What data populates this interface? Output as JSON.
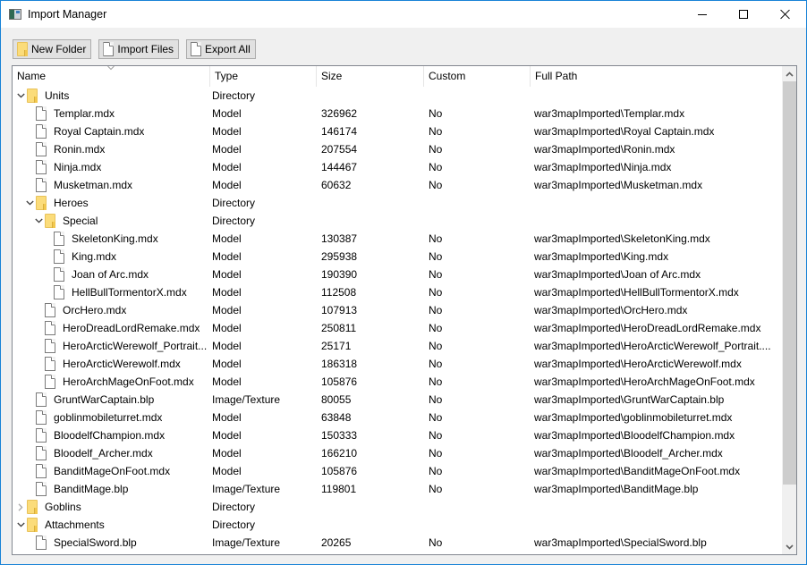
{
  "window": {
    "title": "Import Manager",
    "controls": {
      "minimize": "minimize",
      "maximize": "maximize",
      "close": "close"
    }
  },
  "toolbar": {
    "buttons": [
      {
        "label": "New Folder",
        "icon": "folder-icon"
      },
      {
        "label": "Import Files",
        "icon": "file-icon"
      },
      {
        "label": "Export All",
        "icon": "file-icon"
      }
    ]
  },
  "tree": {
    "columns": [
      "Name",
      "Type",
      "Size",
      "Custom",
      "Full Path"
    ],
    "sorted_column": "Name",
    "rows": [
      {
        "depth": 0,
        "kind": "folder",
        "expanded": true,
        "name": "Units",
        "type": "Directory",
        "size": "",
        "custom": "",
        "path": ""
      },
      {
        "depth": 1,
        "kind": "file",
        "name": "Templar.mdx",
        "type": "Model",
        "size": "326962",
        "custom": "No",
        "path": "war3mapImported\\Templar.mdx"
      },
      {
        "depth": 1,
        "kind": "file",
        "name": "Royal Captain.mdx",
        "type": "Model",
        "size": "146174",
        "custom": "No",
        "path": "war3mapImported\\Royal Captain.mdx"
      },
      {
        "depth": 1,
        "kind": "file",
        "name": "Ronin.mdx",
        "type": "Model",
        "size": "207554",
        "custom": "No",
        "path": "war3mapImported\\Ronin.mdx"
      },
      {
        "depth": 1,
        "kind": "file",
        "name": "Ninja.mdx",
        "type": "Model",
        "size": "144467",
        "custom": "No",
        "path": "war3mapImported\\Ninja.mdx"
      },
      {
        "depth": 1,
        "kind": "file",
        "name": "Musketman.mdx",
        "type": "Model",
        "size": "60632",
        "custom": "No",
        "path": "war3mapImported\\Musketman.mdx"
      },
      {
        "depth": 1,
        "kind": "folder",
        "expanded": true,
        "name": "Heroes",
        "type": "Directory",
        "size": "",
        "custom": "",
        "path": ""
      },
      {
        "depth": 2,
        "kind": "folder",
        "expanded": true,
        "name": "Special",
        "type": "Directory",
        "size": "",
        "custom": "",
        "path": ""
      },
      {
        "depth": 3,
        "kind": "file",
        "name": "SkeletonKing.mdx",
        "type": "Model",
        "size": "130387",
        "custom": "No",
        "path": "war3mapImported\\SkeletonKing.mdx"
      },
      {
        "depth": 3,
        "kind": "file",
        "name": "King.mdx",
        "type": "Model",
        "size": "295938",
        "custom": "No",
        "path": "war3mapImported\\King.mdx"
      },
      {
        "depth": 3,
        "kind": "file",
        "name": "Joan of Arc.mdx",
        "type": "Model",
        "size": "190390",
        "custom": "No",
        "path": "war3mapImported\\Joan of Arc.mdx"
      },
      {
        "depth": 3,
        "kind": "file",
        "name": "HellBullTormentorX.mdx",
        "type": "Model",
        "size": "112508",
        "custom": "No",
        "path": "war3mapImported\\HellBullTormentorX.mdx"
      },
      {
        "depth": 2,
        "kind": "file",
        "name": "OrcHero.mdx",
        "type": "Model",
        "size": "107913",
        "custom": "No",
        "path": "war3mapImported\\OrcHero.mdx"
      },
      {
        "depth": 2,
        "kind": "file",
        "name": "HeroDreadLordRemake.mdx",
        "type": "Model",
        "size": "250811",
        "custom": "No",
        "path": "war3mapImported\\HeroDreadLordRemake.mdx"
      },
      {
        "depth": 2,
        "kind": "file",
        "name": "HeroArcticWerewolf_Portrait...",
        "type": "Model",
        "size": "25171",
        "custom": "No",
        "path": "war3mapImported\\HeroArcticWerewolf_Portrait...."
      },
      {
        "depth": 2,
        "kind": "file",
        "name": "HeroArcticWerewolf.mdx",
        "type": "Model",
        "size": "186318",
        "custom": "No",
        "path": "war3mapImported\\HeroArcticWerewolf.mdx"
      },
      {
        "depth": 2,
        "kind": "file",
        "name": "HeroArchMageOnFoot.mdx",
        "type": "Model",
        "size": "105876",
        "custom": "No",
        "path": "war3mapImported\\HeroArchMageOnFoot.mdx"
      },
      {
        "depth": 1,
        "kind": "file",
        "name": "GruntWarCaptain.blp",
        "type": "Image/Texture",
        "size": "80055",
        "custom": "No",
        "path": "war3mapImported\\GruntWarCaptain.blp"
      },
      {
        "depth": 1,
        "kind": "file",
        "name": "goblinmobileturret.mdx",
        "type": "Model",
        "size": "63848",
        "custom": "No",
        "path": "war3mapImported\\goblinmobileturret.mdx"
      },
      {
        "depth": 1,
        "kind": "file",
        "name": "BloodelfChampion.mdx",
        "type": "Model",
        "size": "150333",
        "custom": "No",
        "path": "war3mapImported\\BloodelfChampion.mdx"
      },
      {
        "depth": 1,
        "kind": "file",
        "name": "Bloodelf_Archer.mdx",
        "type": "Model",
        "size": "166210",
        "custom": "No",
        "path": "war3mapImported\\Bloodelf_Archer.mdx"
      },
      {
        "depth": 1,
        "kind": "file",
        "name": "BanditMageOnFoot.mdx",
        "type": "Model",
        "size": "105876",
        "custom": "No",
        "path": "war3mapImported\\BanditMageOnFoot.mdx"
      },
      {
        "depth": 1,
        "kind": "file",
        "name": "BanditMage.blp",
        "type": "Image/Texture",
        "size": "119801",
        "custom": "No",
        "path": "war3mapImported\\BanditMage.blp"
      },
      {
        "depth": 0,
        "kind": "folder",
        "expanded": false,
        "name": "Goblins",
        "type": "Directory",
        "size": "",
        "custom": "",
        "path": ""
      },
      {
        "depth": 0,
        "kind": "folder",
        "expanded": true,
        "name": "Attachments",
        "type": "Directory",
        "size": "",
        "custom": "",
        "path": ""
      },
      {
        "depth": 1,
        "kind": "file",
        "name": "SpecialSword.blp",
        "type": "Image/Texture",
        "size": "20265",
        "custom": "No",
        "path": "war3mapImported\\SpecialSword.blp"
      }
    ]
  },
  "scrollbar": {
    "position_fraction": 0.0,
    "visible_fraction": 0.88
  }
}
